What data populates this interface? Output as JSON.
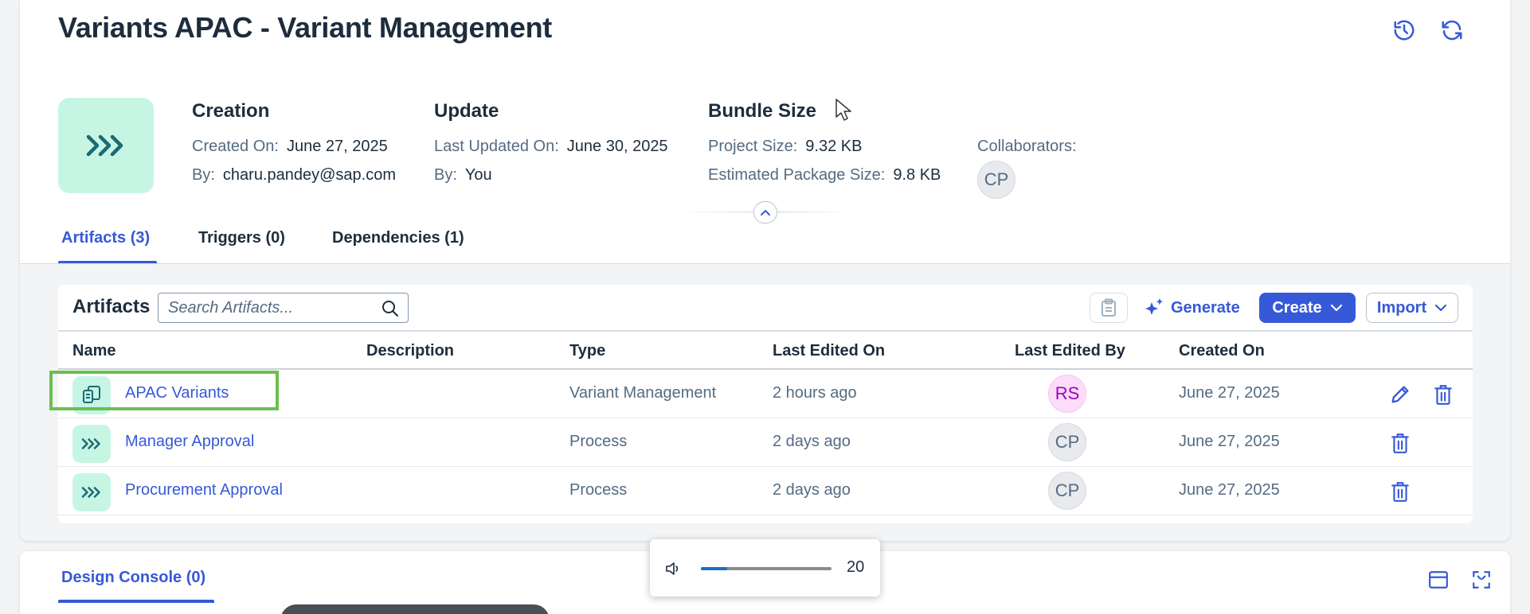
{
  "header": {
    "title": "Variants APAC - Variant Management",
    "history_icon": "history-icon",
    "refresh_icon": "refresh-icon"
  },
  "project": {
    "icon": "process-chevrons-icon",
    "creation": {
      "title": "Creation",
      "created_on_label": "Created On:",
      "created_on_value": "June 27, 2025",
      "by_label": "By:",
      "by_value": "charu.pandey@sap.com"
    },
    "update": {
      "title": "Update",
      "updated_on_label": "Last Updated On:",
      "updated_on_value": "June 30, 2025",
      "by_label": "By:",
      "by_value": "You"
    },
    "bundle": {
      "title": "Bundle Size",
      "project_size_label": "Project Size:",
      "project_size_value": "9.32 KB",
      "package_size_label": "Estimated Package Size:",
      "package_size_value": "9.8 KB"
    },
    "collaborators": {
      "label": "Collaborators:",
      "avatar": "CP"
    }
  },
  "tabs": [
    {
      "label": "Artifacts (3)",
      "active": true
    },
    {
      "label": "Triggers (0)",
      "active": false
    },
    {
      "label": "Dependencies (1)",
      "active": false
    }
  ],
  "artifacts": {
    "title": "Artifacts",
    "search_placeholder": "Search Artifacts...",
    "generate_label": "Generate",
    "create_label": "Create",
    "import_label": "Import",
    "columns": [
      "Name",
      "Description",
      "Type",
      "Last Edited On",
      "Last Edited By",
      "Created On"
    ],
    "rows": [
      {
        "name": "APAC Variants",
        "description": "",
        "type": "Variant Management",
        "last_edited_on": "2 hours ago",
        "last_edited_by": "RS",
        "created_on": "June 27, 2025",
        "icon": "variant-copy-icon"
      },
      {
        "name": "Manager Approval",
        "description": "",
        "type": "Process",
        "last_edited_on": "2 days ago",
        "last_edited_by": "CP",
        "created_on": "June 27, 2025",
        "icon": "process-chevrons-icon"
      },
      {
        "name": "Procurement Approval",
        "description": "",
        "type": "Process",
        "last_edited_on": "2 days ago",
        "last_edited_by": "CP",
        "created_on": "June 27, 2025",
        "icon": "process-chevrons-icon"
      }
    ]
  },
  "design_console": {
    "tab_label": "Design Console (0)"
  },
  "volume_overlay": {
    "value": "20",
    "level_fraction": 0.2
  },
  "colors": {
    "accent": "#3659d8",
    "icon_bg": "#c7f5e4",
    "highlight": "#6bbf4e"
  }
}
